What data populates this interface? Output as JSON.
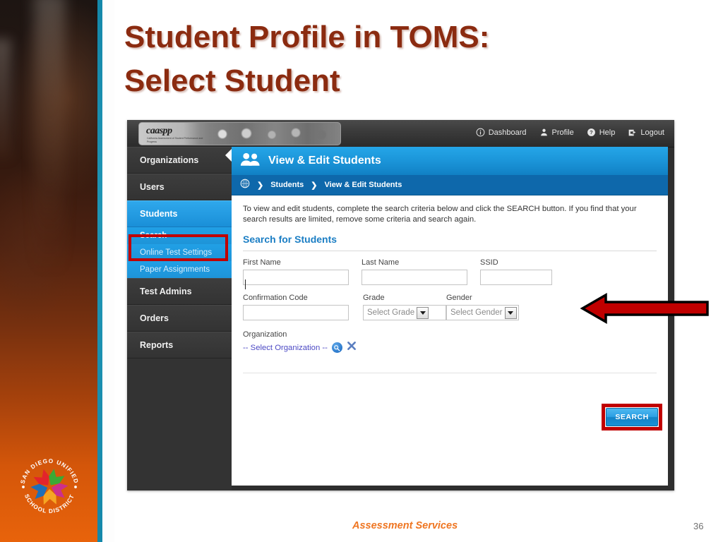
{
  "slide": {
    "title_line1": "Student Profile in TOMS:",
    "title_line2": "Select Student",
    "title_color": "#8b2b10",
    "footer_label": "Assessment Services",
    "page_number": "36"
  },
  "district_logo": {
    "arc_top": "SAN DIEGO UNIFIED",
    "arc_bottom": "SCHOOL DISTRICT",
    "petal_colors": [
      "#e3242b",
      "#3aa935",
      "#cc2f8c",
      "#f5a623",
      "#1d6fb8"
    ]
  },
  "app": {
    "brand": {
      "logo_text": "caaspp",
      "tagline": "California Assessment of Student Performance and Progress"
    },
    "topnav": [
      {
        "label": "Dashboard",
        "icon": "info-circle-icon"
      },
      {
        "label": "Profile",
        "icon": "person-icon"
      },
      {
        "label": "Help",
        "icon": "question-circle-icon"
      },
      {
        "label": "Logout",
        "icon": "logout-icon"
      }
    ],
    "sidebar": {
      "items": [
        {
          "label": "Organizations",
          "active": false
        },
        {
          "label": "Users",
          "active": false
        },
        {
          "label": "Students",
          "active": true
        }
      ],
      "subitems": [
        {
          "label": "Search",
          "current": true
        },
        {
          "label": "Online Test Settings",
          "current": false
        },
        {
          "label": "Paper Assignments",
          "current": false
        }
      ],
      "items_after": [
        {
          "label": "Test Admins",
          "active": false
        },
        {
          "label": "Orders",
          "active": false
        },
        {
          "label": "Reports",
          "active": false
        }
      ]
    },
    "content": {
      "page_title": "View & Edit Students",
      "page_icon": "people-icon",
      "breadcrumb": [
        "Students",
        "View & Edit Students"
      ],
      "breadcrumb_separator": "❯",
      "intro": "To view and edit students, complete the search criteria below and click the SEARCH button. If you find that your search results are limited, remove some criteria and search again.",
      "search_heading": "Search for Students",
      "fields": {
        "first_name": {
          "label": "First Name",
          "value": ""
        },
        "last_name": {
          "label": "Last Name",
          "value": ""
        },
        "ssid": {
          "label": "SSID",
          "value": ""
        },
        "confirmation_code": {
          "label": "Confirmation Code",
          "value": ""
        },
        "grade": {
          "label": "Grade",
          "value": "Select Grade"
        },
        "gender": {
          "label": "Gender",
          "value": "Select Gender"
        },
        "organization": {
          "label": "Organization",
          "value": "-- Select Organization --"
        }
      },
      "search_button": "SEARCH"
    },
    "colors": {
      "accent_blue": "#1a93d7",
      "breadcrumb_blue": "#0e68ab",
      "sidebar_dark": "#333333",
      "highlight_red": "#c00000",
      "link_purple": "#4c49c4",
      "heading_blue": "#1b7ec4"
    }
  },
  "annotations": {
    "arrow": {
      "direction": "left",
      "fill": "#c00000",
      "stroke": "#000000"
    },
    "highlight_students": "#c00000",
    "highlight_search_button": "#c00000"
  }
}
